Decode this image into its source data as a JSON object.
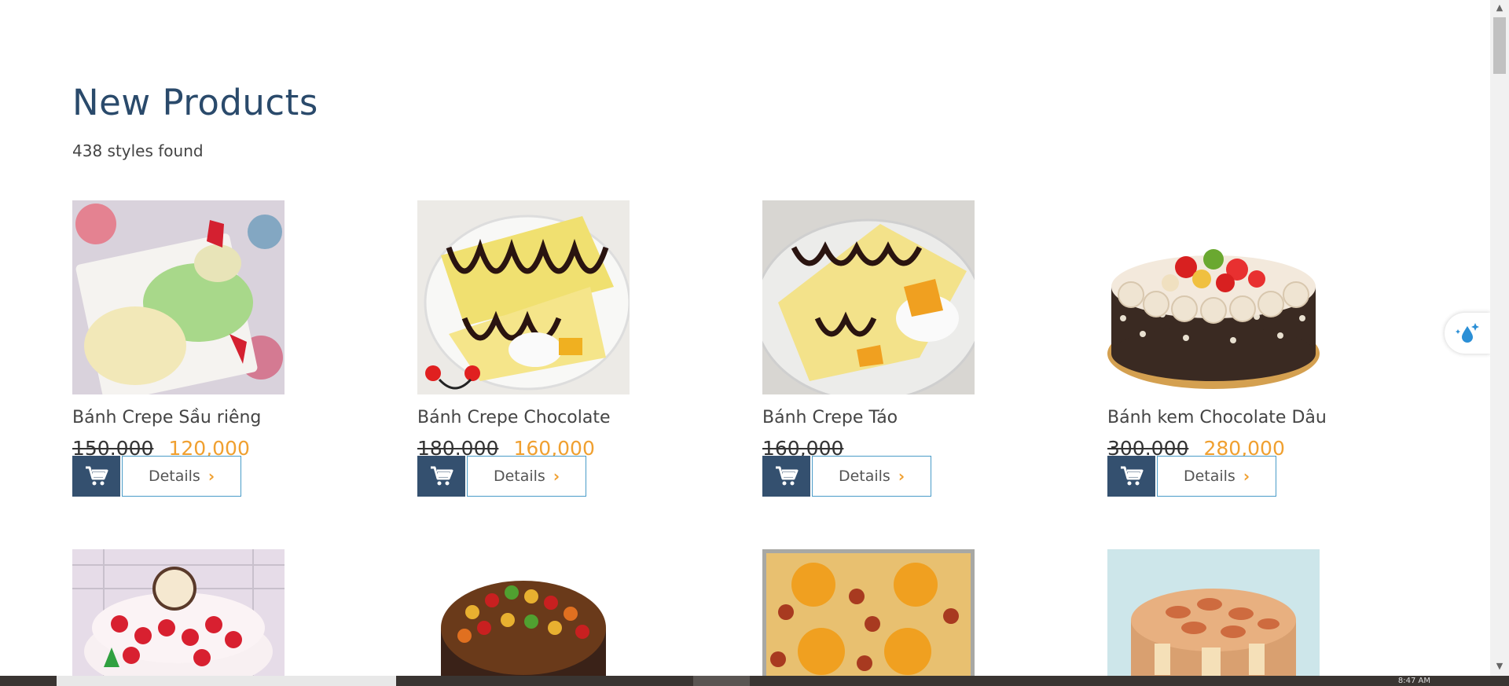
{
  "section": {
    "title": "New Products",
    "count_text": "438 styles found"
  },
  "products": [
    {
      "name": "Bánh Crepe Sầu riêng",
      "old_price": "150.000",
      "new_price": "120,000",
      "details_label": "Details"
    },
    {
      "name": "Bánh Crepe Chocolate",
      "old_price": "180.000",
      "new_price": "160,000",
      "details_label": "Details"
    },
    {
      "name": "Bánh Crepe Táo",
      "old_price": "160,000",
      "new_price": "",
      "details_label": "Details"
    },
    {
      "name": "Bánh kem Chocolate Dâu",
      "old_price": "300.000",
      "new_price": "280,000",
      "details_label": "Details"
    }
  ],
  "taskbar": {
    "clock": "8:47 AM"
  },
  "colors": {
    "heading": "#2a4a6b",
    "accent_price": "#f0a030",
    "cart_button": "#34506f",
    "details_border": "#4a9cc8"
  },
  "icons": {
    "cart": "shopping-cart-icon",
    "details_arrow": "chevron-right-icon",
    "float_tab": "water-drop-sparkle-icon"
  }
}
